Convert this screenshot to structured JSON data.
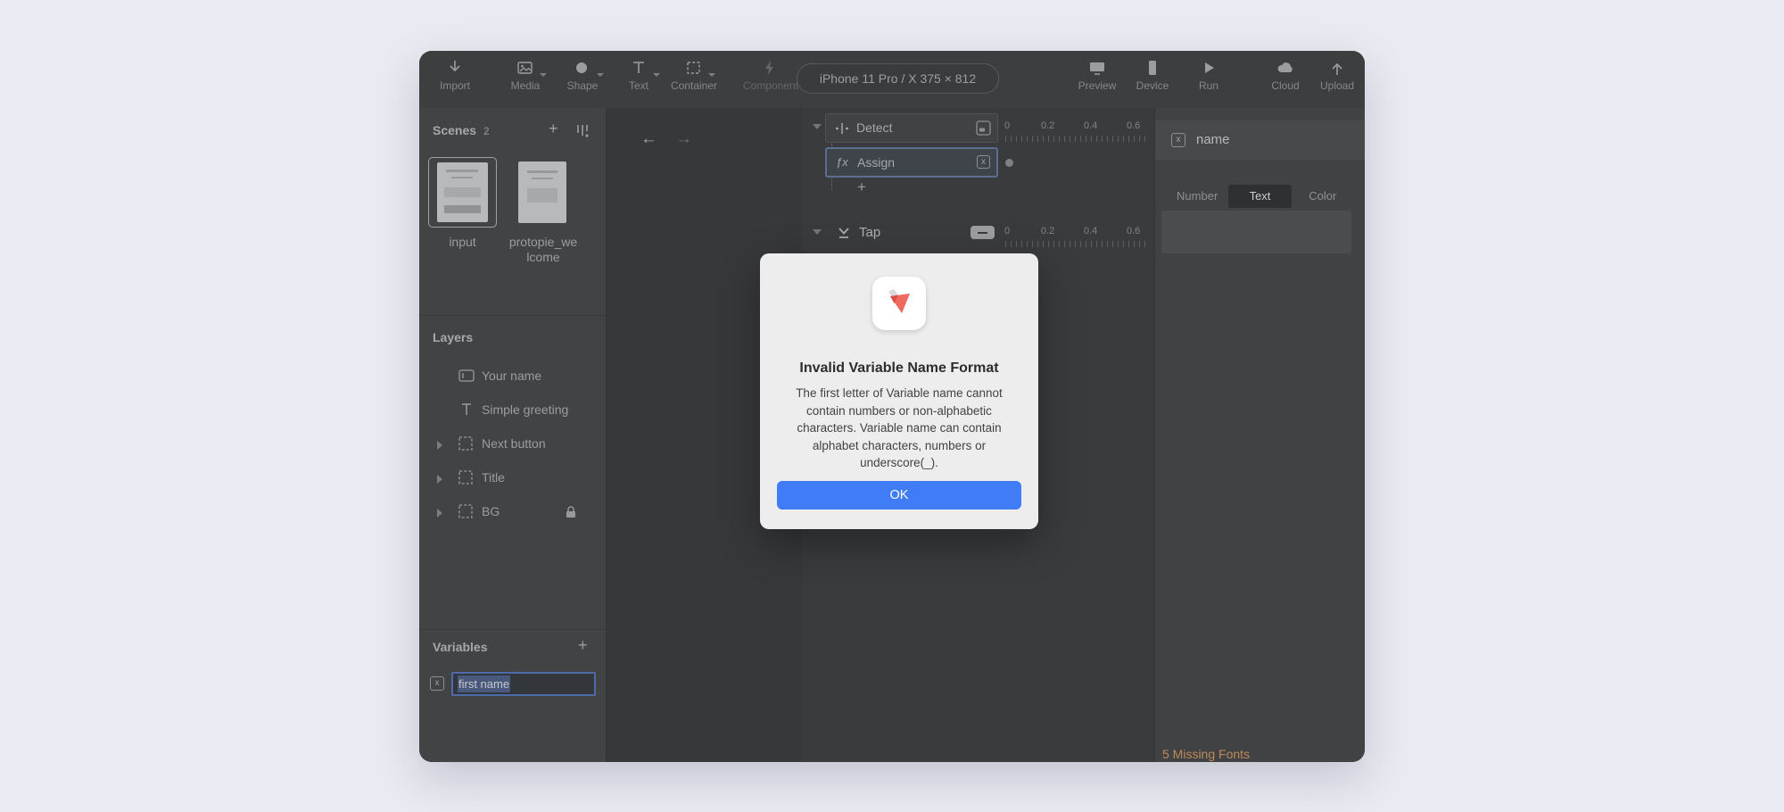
{
  "toolbar": {
    "tools": [
      {
        "label": "Import"
      },
      {
        "label": "Media"
      },
      {
        "label": "Shape"
      },
      {
        "label": "Text"
      },
      {
        "label": "Container"
      },
      {
        "label": "Component"
      }
    ],
    "device_pill": "iPhone 11 Pro / X  375 × 812",
    "right_tools": [
      {
        "label": "Preview"
      },
      {
        "label": "Device"
      },
      {
        "label": "Run"
      }
    ],
    "far_tools": [
      {
        "label": "Cloud"
      },
      {
        "label": "Upload"
      }
    ]
  },
  "scenes": {
    "title": "Scenes",
    "count": "2",
    "items": [
      {
        "label": "input"
      },
      {
        "label": "protopie_welcome"
      }
    ]
  },
  "layers": {
    "title": "Layers",
    "items": [
      {
        "label": "Your name"
      },
      {
        "label": "Simple greeting"
      },
      {
        "label": "Next button"
      },
      {
        "label": "Title"
      },
      {
        "label": "BG"
      }
    ]
  },
  "variables": {
    "title": "Variables",
    "value": "first name"
  },
  "triggers": {
    "detect": "Detect",
    "assign": "Assign",
    "tap": "Tap",
    "timeline_ticks": [
      "0",
      "0.2",
      "0.4",
      "0.6"
    ]
  },
  "inspector": {
    "title": "name",
    "tabs": [
      "Number",
      "Text",
      "Color"
    ],
    "active_tab": "Text"
  },
  "statusbar": {
    "missing_fonts": "5 Missing Fonts"
  },
  "dialog": {
    "title": "Invalid Variable Name Format",
    "body": "The first letter of Variable name cannot contain numbers or non-alphabetic characters. Variable name can contain alphabet characters, numbers or underscore(_).",
    "ok": "OK"
  },
  "icons": {
    "back": "←",
    "forward": "→",
    "plus": "+",
    "x": "x",
    "fx": "ƒx"
  },
  "colors": {
    "accent_blue": "#3f7cf6",
    "selection_blue": "#5c6d94",
    "brand_coral": "#ee6a5e",
    "warning_orange": "#c08a58"
  }
}
